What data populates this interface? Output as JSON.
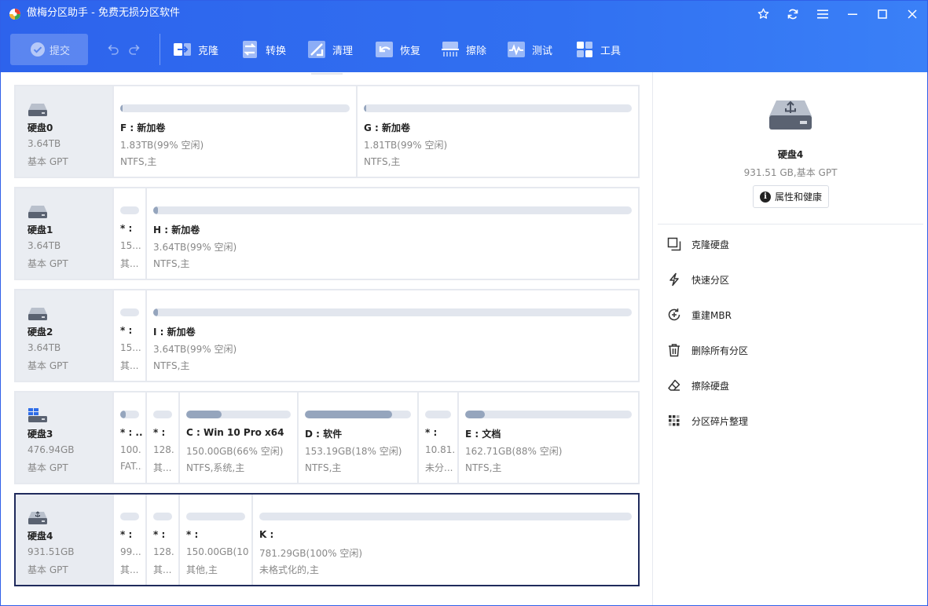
{
  "app": {
    "title": "傲梅分区助手 - 免费无损分区软件"
  },
  "toolbar": {
    "commit_label": "提交",
    "tools": [
      {
        "label": "克隆",
        "icon": "clone-icon"
      },
      {
        "label": "转换",
        "icon": "convert-icon"
      },
      {
        "label": "清理",
        "icon": "clean-icon"
      },
      {
        "label": "恢复",
        "icon": "recover-icon"
      },
      {
        "label": "擦除",
        "icon": "wipe-icon"
      },
      {
        "label": "测试",
        "icon": "test-icon"
      },
      {
        "label": "工具",
        "icon": "tools-icon"
      }
    ]
  },
  "disks": [
    {
      "name": "硬盘0",
      "size": "3.64TB",
      "type": "基本 GPT",
      "partitions": [
        {
          "name": "F : 新加卷",
          "capacity": "1.83TB(99% 空闲)",
          "fs": "NTFS,主",
          "used": 0.01
        },
        {
          "name": "G : 新加卷",
          "capacity": "1.81TB(99% 空闲)",
          "fs": "NTFS,主",
          "used": 0.01
        }
      ]
    },
    {
      "name": "硬盘1",
      "size": "3.64TB",
      "type": "基本 GPT",
      "partitions": [
        {
          "name": "* :",
          "capacity": "15....",
          "fs": "其...",
          "used": 0
        },
        {
          "name": "H : 新加卷",
          "capacity": "3.64TB(99% 空闲)",
          "fs": "NTFS,主",
          "used": 0.01
        }
      ]
    },
    {
      "name": "硬盘2",
      "size": "3.64TB",
      "type": "基本 GPT",
      "partitions": [
        {
          "name": "* :",
          "capacity": "15....",
          "fs": "其...",
          "used": 0
        },
        {
          "name": "I : 新加卷",
          "capacity": "3.64TB(99% 空闲)",
          "fs": "NTFS,主",
          "used": 0.01
        }
      ]
    },
    {
      "name": "硬盘3",
      "size": "476.94GB",
      "type": "基本 GPT",
      "partitions": [
        {
          "name": "* : ...",
          "capacity": "100...",
          "fs": "FAT...",
          "used": 0.3
        },
        {
          "name": "* :",
          "capacity": "128...",
          "fs": "其...",
          "used": 0
        },
        {
          "name": "C : Win 10 Pro x64",
          "capacity": "150.00GB(66% 空闲)",
          "fs": "NTFS,系统,主",
          "used": 0.34
        },
        {
          "name": "D : 软件",
          "capacity": "153.19GB(18% 空闲)",
          "fs": "NTFS,主",
          "used": 0.82
        },
        {
          "name": "* :",
          "capacity": "10.81...",
          "fs": "未分...",
          "used": 0
        },
        {
          "name": "E : 文档",
          "capacity": "162.71GB(88% 空闲)",
          "fs": "NTFS,主",
          "used": 0.12
        }
      ]
    },
    {
      "name": "硬盘4",
      "size": "931.51GB",
      "type": "基本 GPT",
      "partitions": [
        {
          "name": "* :",
          "capacity": "99....",
          "fs": "其...",
          "used": 0
        },
        {
          "name": "* :",
          "capacity": "128...",
          "fs": "其...",
          "used": 0
        },
        {
          "name": "* :",
          "capacity": "150.00GB(10...",
          "fs": "其他,主",
          "used": 0
        },
        {
          "name": "K :",
          "capacity": "781.29GB(100% 空闲)",
          "fs": "未格式化的,主",
          "used": 0
        }
      ]
    }
  ],
  "side": {
    "disk_title": "硬盘4",
    "disk_sub": "931.51 GB,基本 GPT",
    "health_label": "属性和健康",
    "actions": [
      {
        "label": "克隆硬盘",
        "icon": "clone-disk-icon"
      },
      {
        "label": "快速分区",
        "icon": "quick-partition-icon"
      },
      {
        "label": "重建MBR",
        "icon": "rebuild-mbr-icon"
      },
      {
        "label": "删除所有分区",
        "icon": "trash-icon"
      },
      {
        "label": "擦除硬盘",
        "icon": "eraser-icon"
      },
      {
        "label": "分区碎片整理",
        "icon": "defrag-icon"
      }
    ]
  },
  "colors": {
    "accent": "#2d63ec",
    "bar_track": "#e2e6ee",
    "bar_fill": "#95a5bd",
    "selected_border": "#1f2a5c"
  }
}
